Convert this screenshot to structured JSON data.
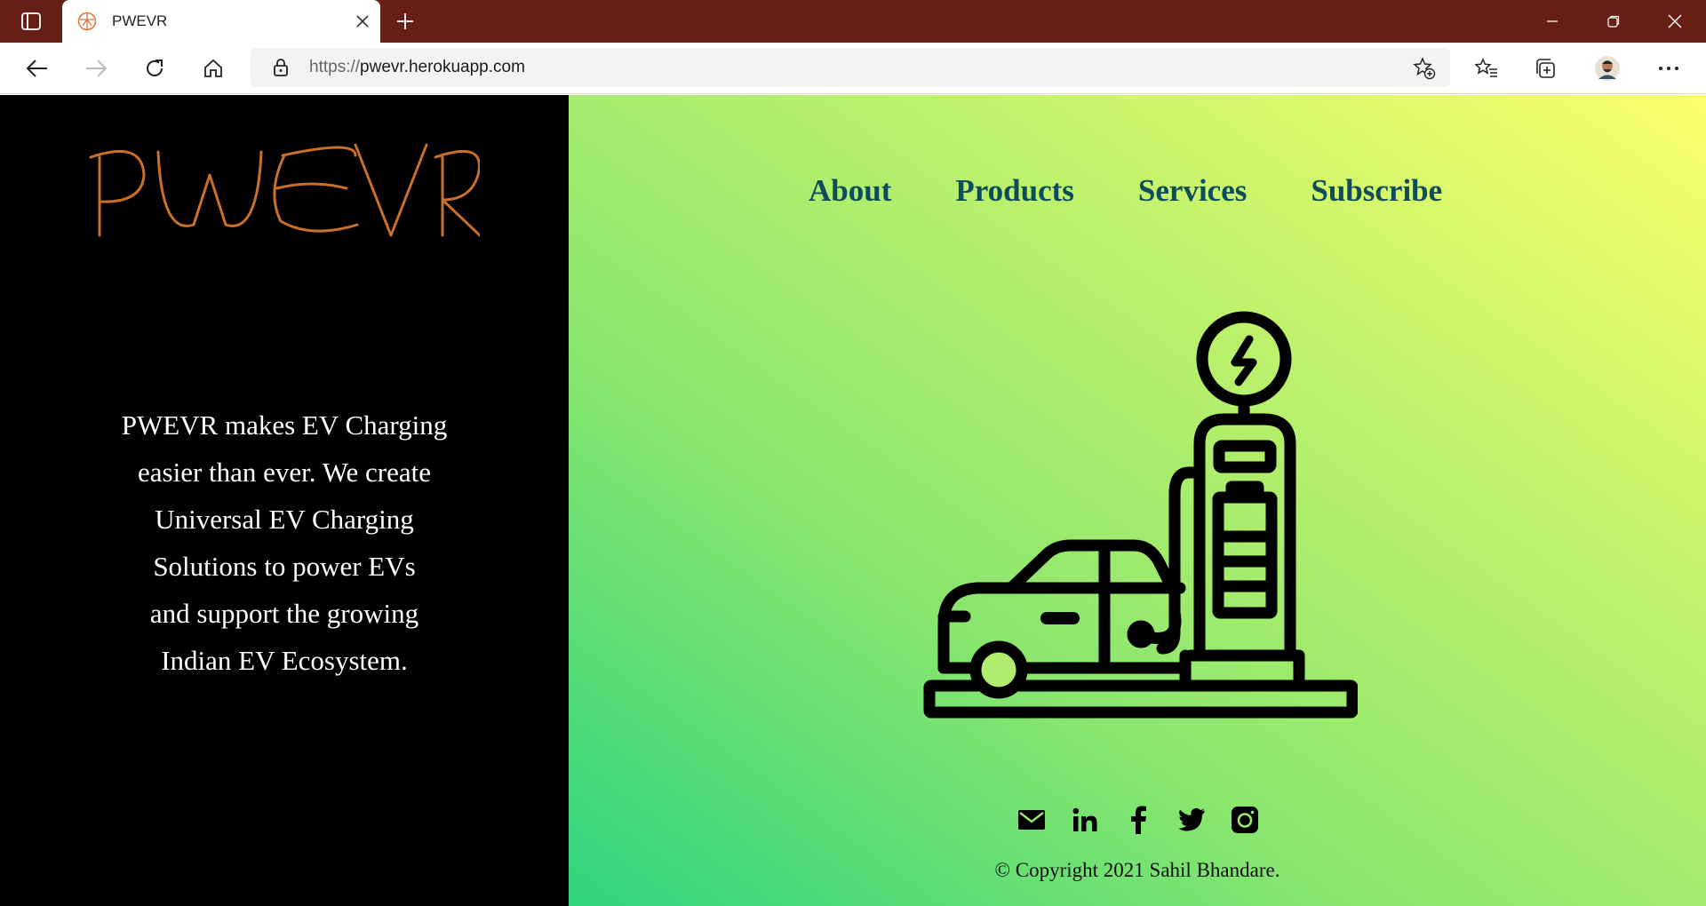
{
  "browser": {
    "tab_title": "PWEVR",
    "url_protocol": "https://",
    "url_host": "pwevr.herokuapp.com",
    "titlebar_color": "#651f15"
  },
  "site": {
    "logo_text": "PWEVR",
    "logo_color": "#c8702a",
    "tagline": "PWEVR makes EV Charging easier than ever. We create Universal EV Charging Solutions to power EVs and support the growing Indian EV Ecosystem.",
    "tagline_lines": [
      "PWEVR makes EV Charging",
      "easier than ever. We create",
      "Universal EV Charging",
      "Solutions to power EVs",
      "and support the growing",
      "Indian EV Ecosystem."
    ],
    "nav": [
      {
        "label": "About"
      },
      {
        "label": "Products"
      },
      {
        "label": "Services"
      },
      {
        "label": "Subscribe"
      }
    ],
    "nav_color": "#0e4c5c",
    "hero_icon": "ev-charging-station-icon",
    "socials": [
      {
        "name": "email-icon"
      },
      {
        "name": "linkedin-icon"
      },
      {
        "name": "facebook-icon"
      },
      {
        "name": "twitter-icon"
      },
      {
        "name": "instagram-icon"
      }
    ],
    "copyright": "© Copyright 2021 Sahil Bhandare."
  }
}
